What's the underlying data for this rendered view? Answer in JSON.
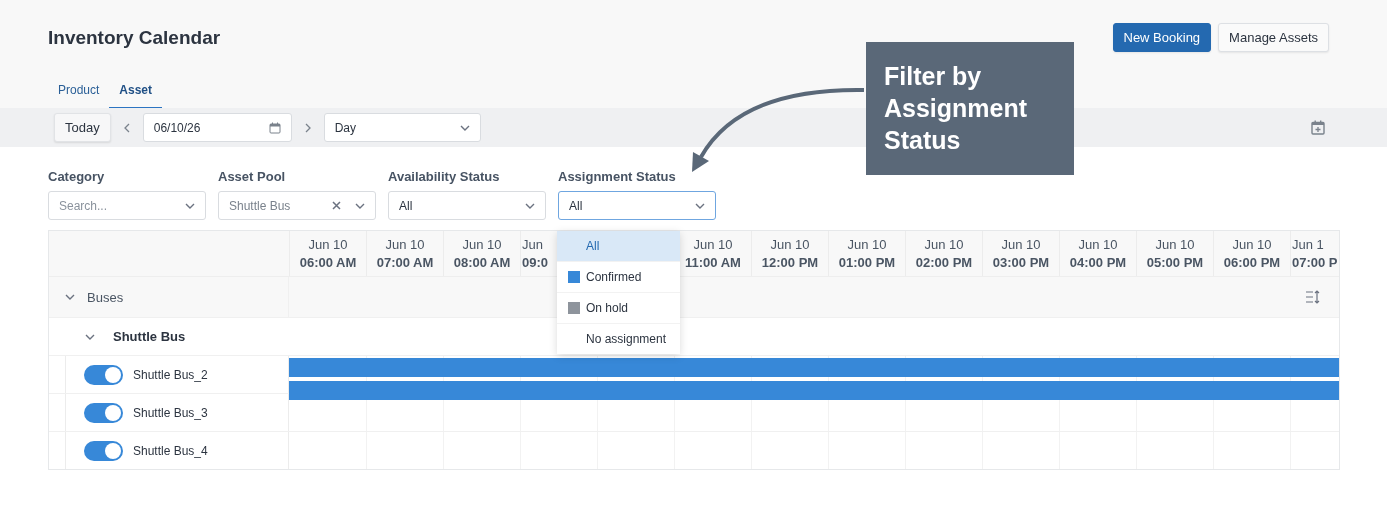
{
  "title": "Inventory Calendar",
  "buttons": [
    {
      "label": "New Booking",
      "kind": "primary"
    },
    {
      "label": "Manage Assets",
      "kind": "secondary"
    }
  ],
  "tabs": [
    {
      "label": "Product",
      "selected": false
    },
    {
      "label": "Asset",
      "selected": true
    }
  ],
  "toolbar": {
    "today": "Today",
    "date": "06/10/26",
    "view": "Day"
  },
  "filters": [
    {
      "label": "Category",
      "placeholder": "Search..."
    },
    {
      "label": "Asset Pool",
      "value": "Shuttle Bus",
      "disabled": true,
      "clearable": true
    },
    {
      "label": "Availability Status",
      "value": "All"
    },
    {
      "label": "Assignment Status",
      "value": "All",
      "focused": true,
      "options": [
        {
          "label": "All",
          "selected": true
        },
        {
          "label": "Confirmed",
          "selected": false,
          "color": "#3788d8"
        },
        {
          "label": "On hold",
          "selected": false,
          "color": "#8e949c"
        },
        {
          "label": "No assignment",
          "selected": false
        }
      ]
    }
  ],
  "grid": {
    "columns": [
      {
        "date": "Jun 10",
        "time": "06:00 AM"
      },
      {
        "date": "Jun 10",
        "time": "07:00 AM"
      },
      {
        "date": "Jun 10",
        "time": "08:00 AM"
      },
      {
        "date": "Jun",
        "time": "09:0",
        "cut": true
      },
      {},
      {
        "date": "Jun 10",
        "time": "11:00 AM"
      },
      {
        "date": "Jun 10",
        "time": "12:00 PM"
      },
      {
        "date": "Jun 10",
        "time": "01:00 PM"
      },
      {
        "date": "Jun 10",
        "time": "02:00 PM"
      },
      {
        "date": "Jun 10",
        "time": "03:00 PM"
      },
      {
        "date": "Jun 10",
        "time": "04:00 PM"
      },
      {
        "date": "Jun 10",
        "time": "05:00 PM"
      },
      {
        "date": "Jun 10",
        "time": "06:00 PM"
      },
      {
        "date": "Jun 1",
        "time": "07:00 P",
        "cut": true
      }
    ],
    "groups": [
      {
        "name": "Buses",
        "expanded": true,
        "children": [
          {
            "name": "Shuttle Bus",
            "expanded": true,
            "children": [
              {
                "name": "Shuttle Bus_2",
                "on": true,
                "bookings": [
                  {
                    "color": "#3788d8"
                  },
                  {
                    "color": "#3788d8"
                  }
                ]
              },
              {
                "name": "Shuttle Bus_3",
                "on": true
              },
              {
                "name": "Shuttle Bus_4",
                "on": true
              }
            ]
          }
        ]
      }
    ]
  },
  "callout": {
    "text": "Filter by Assignment Status"
  }
}
